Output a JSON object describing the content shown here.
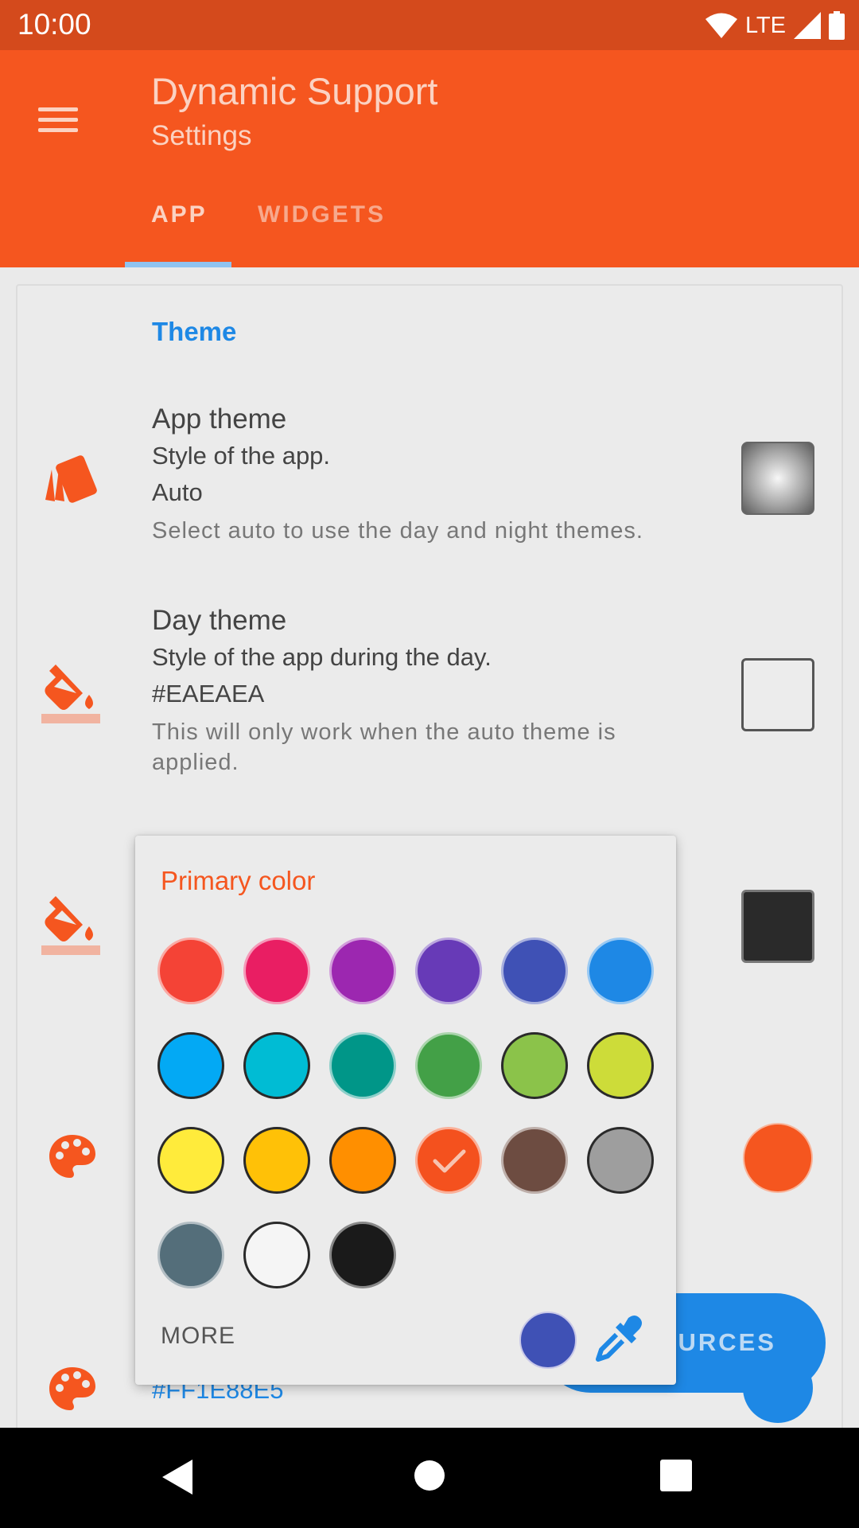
{
  "status_bar": {
    "time": "10:00",
    "network": "LTE"
  },
  "app_bar": {
    "title": "Dynamic Support",
    "subtitle": "Settings"
  },
  "tabs": [
    {
      "label": "APP",
      "selected": true
    },
    {
      "label": "WIDGETS",
      "selected": false
    }
  ],
  "section": {
    "title": "Theme"
  },
  "prefs": {
    "app_theme": {
      "title": "App theme",
      "summary": "Style of the app.",
      "value": "Auto",
      "description": "Select auto to use the day and night themes."
    },
    "day_theme": {
      "title": "Day theme",
      "summary": "Style of the app during the day.",
      "value": "#EAEAEA",
      "description": "This will only work when the auto theme is applied."
    },
    "background_color": {
      "value": "#FF1E88E5"
    }
  },
  "color_picker": {
    "title": "Primary color",
    "selected_color": "#f4511e",
    "colors": [
      "#f44336",
      "#e91e63",
      "#9c27b0",
      "#673ab7",
      "#3f51b5",
      "#1e88e5",
      "#03a9f4",
      "#00bcd4",
      "#009688",
      "#43a047",
      "#8bc34a",
      "#cddc39",
      "#ffeb3b",
      "#ffc107",
      "#ff8f00",
      "#f4511e",
      "#6d4c41",
      "#9e9e9e",
      "#546e7a",
      "#f5f5f5",
      "#1a1a1a"
    ],
    "more_label": "MORE",
    "recent_color": "#3f51b5"
  },
  "fab": {
    "label": "OURCES"
  },
  "colors": {
    "accent": "#f5561f",
    "primary_dark": "#d44a1c",
    "link": "#1e88e5"
  }
}
